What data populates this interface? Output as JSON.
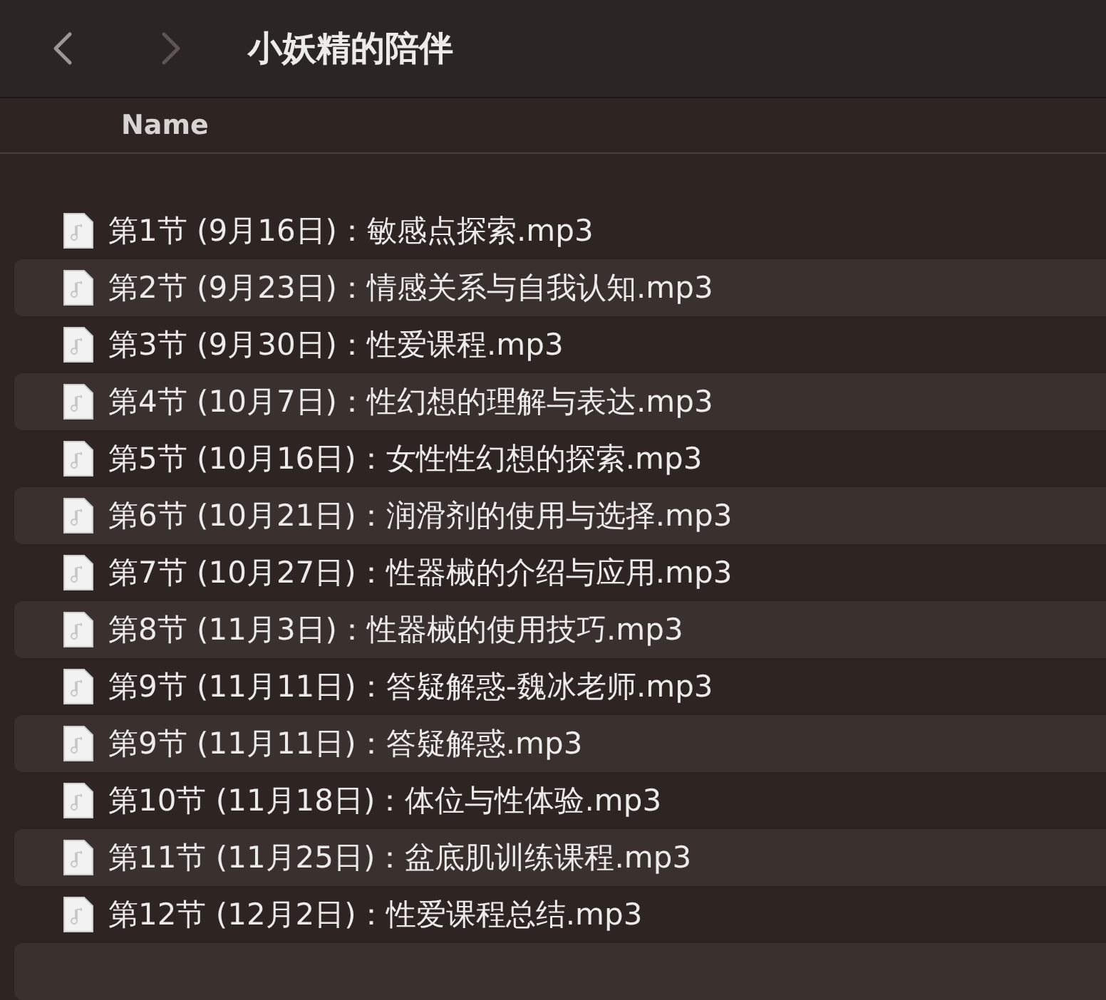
{
  "window": {
    "title": "小妖精的陪伴"
  },
  "navigation": [
    {
      "kind": "back",
      "disabled": false
    },
    {
      "kind": "forward",
      "disabled": true
    }
  ],
  "table": {
    "columns": [
      "Name"
    ],
    "rows": [
      {
        "name": "第1节 (9月16日)：敏感点探索.mp3"
      },
      {
        "name": "第2节 (9月23日)：情感关系与自我认知.mp3"
      },
      {
        "name": "第3节 (9月30日)：性爱课程.mp3"
      },
      {
        "name": "第4节 (10月7日)：性幻想的理解与表达.mp3"
      },
      {
        "name": "第5节 (10月16日)：女性性幻想的探索.mp3"
      },
      {
        "name": "第6节 (10月21日)：润滑剂的使用与选择.mp3"
      },
      {
        "name": "第7节 (10月27日)：性器械的介绍与应用.mp3"
      },
      {
        "name": "第8节 (11月3日)：性器械的使用技巧.mp3"
      },
      {
        "name": "第9节 (11月11日)：答疑解惑-魏冰老师.mp3"
      },
      {
        "name": "第9节 (11月11日)：答疑解惑.mp3"
      },
      {
        "name": "第10节 (11月18日)：体位与性体验.mp3"
      },
      {
        "name": "第11节 (11月25日)：盆底肌训练课程.mp3"
      },
      {
        "name": "第12节 (12月2日)：性爱课程总结.mp3"
      }
    ]
  }
}
